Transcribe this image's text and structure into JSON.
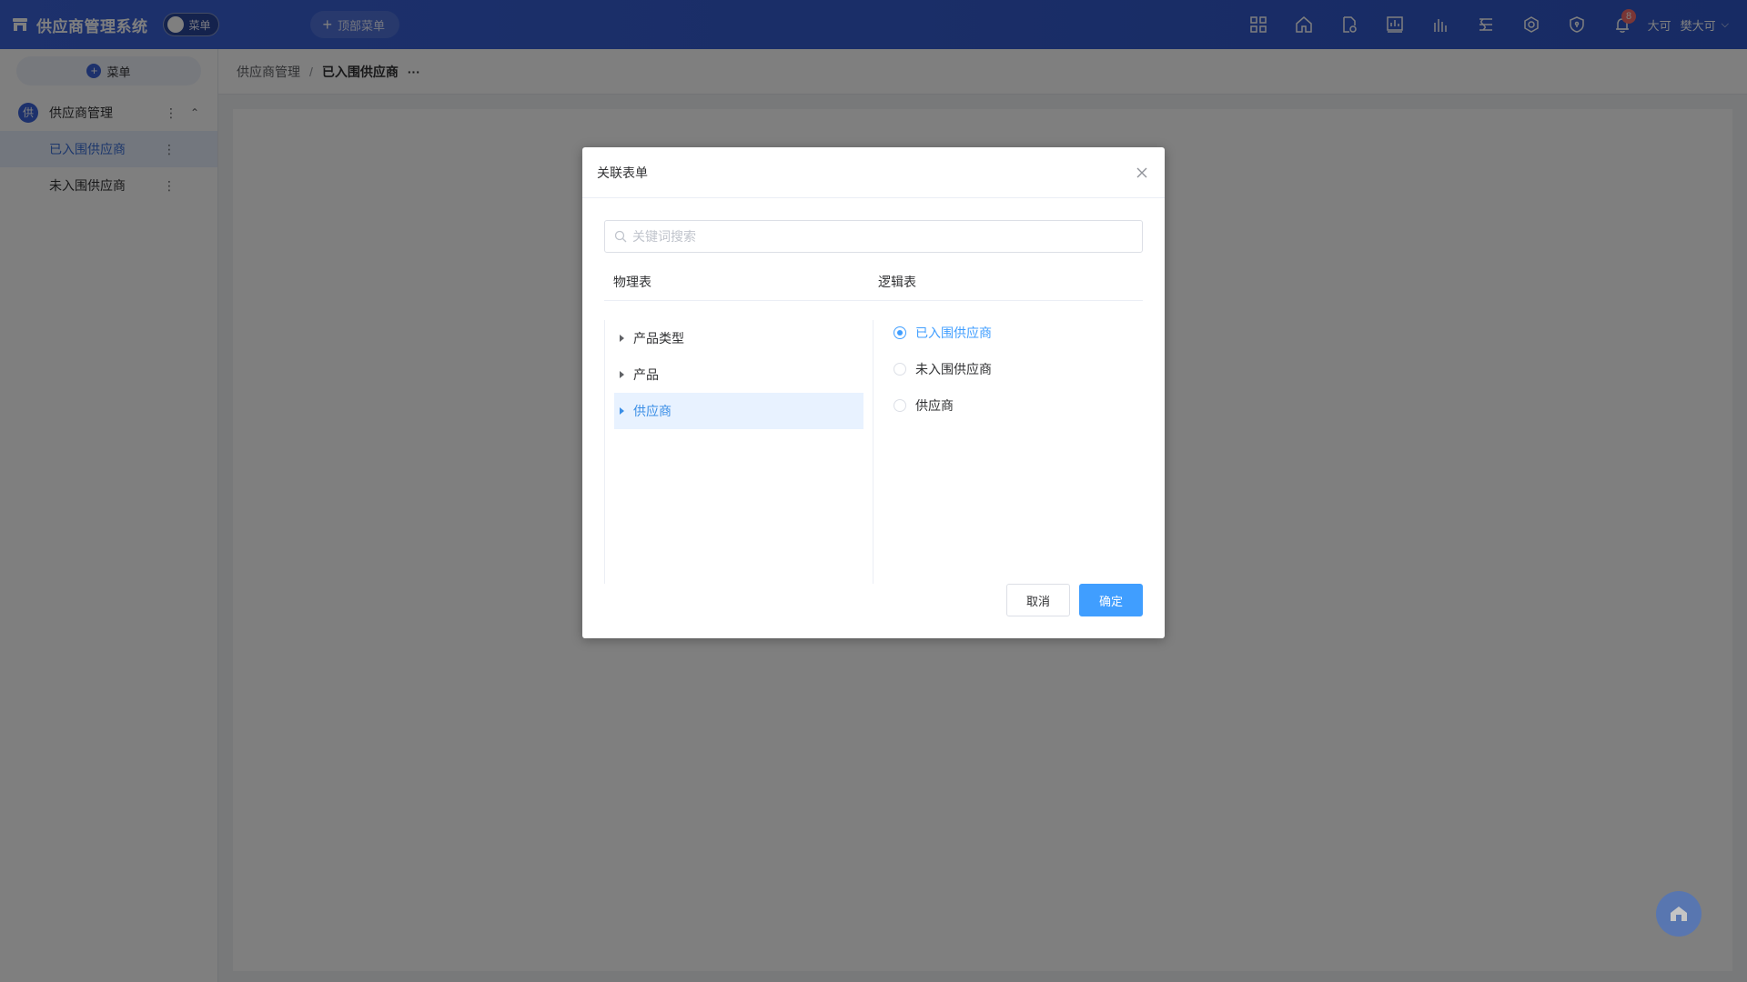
{
  "app": {
    "title": "供应商管理系统",
    "menu_toggle_label": "菜单",
    "top_menu_label": "顶部菜单"
  },
  "header": {
    "icons": [
      "apps-icon",
      "home-icon",
      "file-settings-icon",
      "dashboard-icon",
      "chart-icon",
      "dataset-icon",
      "settings-icon",
      "shield-icon",
      "bell-icon"
    ],
    "notification_count": "8",
    "user_short": "大可",
    "user_name": "樊大可"
  },
  "sidebar": {
    "add_label": "菜单",
    "group": {
      "icon_text": "供",
      "label": "供应商管理"
    },
    "items": [
      {
        "label": "已入围供应商",
        "active": true
      },
      {
        "label": "未入围供应商",
        "active": false
      }
    ]
  },
  "breadcrumb": {
    "parent": "供应商管理",
    "separator": "/",
    "current": "已入围供应商",
    "more": "···"
  },
  "dialog": {
    "title": "关联表单",
    "search_placeholder": "关键词搜索",
    "physical_header": "物理表",
    "logical_header": "逻辑表",
    "physical_tables": [
      {
        "label": "产品类型",
        "selected": false
      },
      {
        "label": "产品",
        "selected": false
      },
      {
        "label": "供应商",
        "selected": true
      }
    ],
    "logical_tables": [
      {
        "label": "已入围供应商",
        "checked": true
      },
      {
        "label": "未入围供应商",
        "checked": false
      },
      {
        "label": "供应商",
        "checked": false
      }
    ],
    "cancel_label": "取消",
    "confirm_label": "确定"
  }
}
